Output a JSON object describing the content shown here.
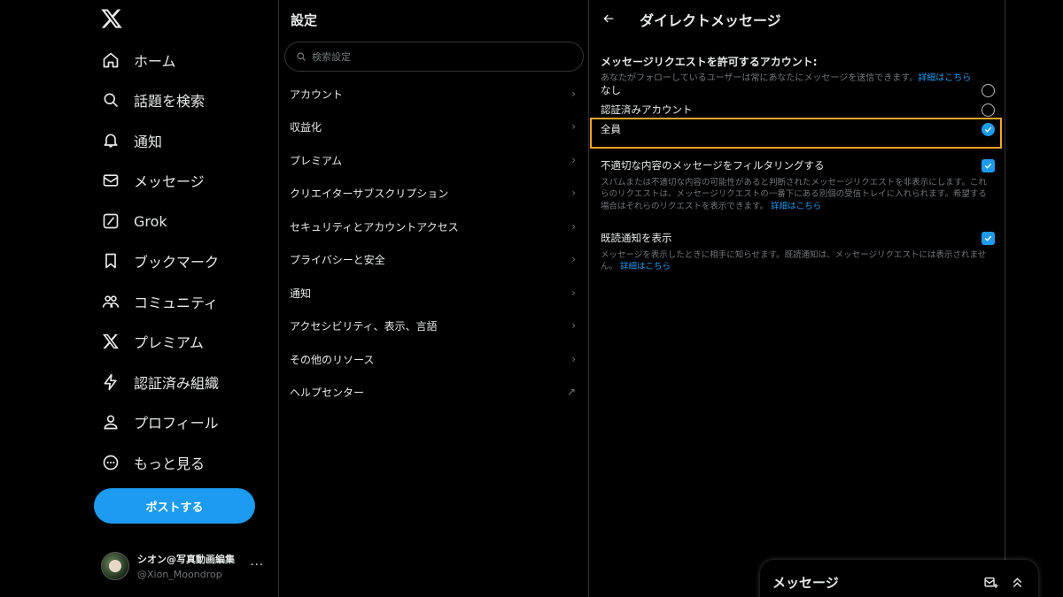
{
  "nav": {
    "items": [
      {
        "label": "ホーム",
        "icon": "home-icon"
      },
      {
        "label": "話題を検索",
        "icon": "search-icon"
      },
      {
        "label": "通知",
        "icon": "bell-icon"
      },
      {
        "label": "メッセージ",
        "icon": "mail-icon"
      },
      {
        "label": "Grok",
        "icon": "grok-icon"
      },
      {
        "label": "ブックマーク",
        "icon": "bookmark-icon"
      },
      {
        "label": "コミュニティ",
        "icon": "community-icon"
      },
      {
        "label": "プレミアム",
        "icon": "x-premium-icon"
      },
      {
        "label": "認証済み組織",
        "icon": "lightning-icon"
      },
      {
        "label": "プロフィール",
        "icon": "person-icon"
      },
      {
        "label": "もっと見る",
        "icon": "more-circle-icon"
      }
    ],
    "post_button": "ポストする",
    "profile": {
      "name": "シオン@写真動画編集",
      "handle": "@Xion_Moondrop",
      "more": "···"
    }
  },
  "settings": {
    "title": "設定",
    "search_placeholder": "検索設定",
    "menu": [
      {
        "label": "アカウント",
        "icon": "chevron-right-icon",
        "glyph": "›"
      },
      {
        "label": "収益化",
        "icon": "chevron-right-icon",
        "glyph": "›"
      },
      {
        "label": "プレミアム",
        "icon": "chevron-right-icon",
        "glyph": "›"
      },
      {
        "label": "クリエイターサブスクリプション",
        "icon": "chevron-right-icon",
        "glyph": "›"
      },
      {
        "label": "セキュリティとアカウントアクセス",
        "icon": "chevron-right-icon",
        "glyph": "›"
      },
      {
        "label": "プライバシーと安全",
        "icon": "chevron-right-icon",
        "glyph": "›"
      },
      {
        "label": "通知",
        "icon": "chevron-right-icon",
        "glyph": "›"
      },
      {
        "label": "アクセシビリティ、表示、言語",
        "icon": "chevron-right-icon",
        "glyph": "›"
      },
      {
        "label": "その他のリソース",
        "icon": "chevron-right-icon",
        "glyph": "›"
      },
      {
        "label": "ヘルプセンター",
        "icon": "external-arrow-icon",
        "glyph": "↗"
      }
    ]
  },
  "detail": {
    "title": "ダイレクトメッセージ",
    "request_title": "メッセージリクエストを許可するアカウント:",
    "request_desc": "あなたがフォローしているユーザーは常にあなたにメッセージを送信できます。",
    "request_link": "詳細はこちら",
    "options": [
      {
        "label": "なし",
        "selected": false
      },
      {
        "label": "認証済みアカウント",
        "selected": false
      },
      {
        "label": "全員",
        "selected": true
      }
    ],
    "filter": {
      "label": "不適切な内容のメッセージをフィルタリングする",
      "checked": true,
      "desc": "スパムまたは不適切な内容の可能性があると判断されたメッセージリクエストを非表示にします。これらのリクエストは、メッセージリクエストの一番下にある別個の受信トレイに入れられます。希望する場合はそれらのリクエストを表示できます。",
      "link": "詳細はこちら"
    },
    "read_receipts": {
      "label": "既読通知を表示",
      "checked": true,
      "desc": "メッセージを表示したときに相手に知らせます。既読通知は、メッセージリクエストには表示されません。",
      "link": "詳細はこちら"
    }
  },
  "drawer": {
    "title": "メッセージ"
  },
  "colors": {
    "accent": "#1d9bf0",
    "highlight": "#f5a623",
    "background": "#000000"
  }
}
